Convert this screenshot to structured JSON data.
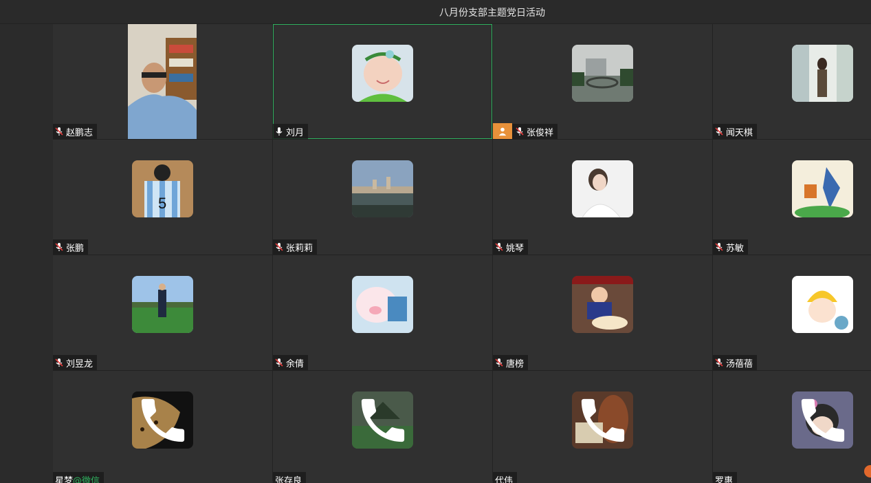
{
  "window": {
    "title": "八月份支部主题党日活动"
  },
  "participants": [
    {
      "name": "赵鹏志",
      "mic": "muted",
      "avatar": "video-portrait"
    },
    {
      "name": "刘月",
      "mic": "on",
      "avatar": "baby-photo",
      "active": true
    },
    {
      "name": "张俊祥",
      "mic": "muted",
      "avatar": "landscape-bridge",
      "badge": "host-icon"
    },
    {
      "name": "闻天棋",
      "mic": "muted",
      "avatar": "window-portrait"
    },
    {
      "name": "张鹏",
      "mic": "muted",
      "avatar": "jersey-photo"
    },
    {
      "name": "张莉莉",
      "mic": "muted",
      "avatar": "lake-city"
    },
    {
      "name": "姚琴",
      "mic": "muted",
      "avatar": "bride-photo"
    },
    {
      "name": "苏敏",
      "mic": "muted",
      "avatar": "drawing-robot"
    },
    {
      "name": "刘昱龙",
      "mic": "muted",
      "avatar": "field-suit"
    },
    {
      "name": "余倩",
      "mic": "muted",
      "avatar": "cartoon-pig"
    },
    {
      "name": "唐榜",
      "mic": "muted",
      "avatar": "child-cake"
    },
    {
      "name": "汤蓓蓓",
      "mic": "muted",
      "avatar": "cartoon-girl-hat"
    },
    {
      "name": "星梦",
      "suffix": "@微信",
      "mic": "none",
      "avatar": "leopard",
      "status": "phone-icon"
    },
    {
      "name": "张存良",
      "mic": "none",
      "avatar": "garden",
      "status": "phone-icon"
    },
    {
      "name": "代伟",
      "mic": "none",
      "avatar": "violin",
      "status": "phone-icon"
    },
    {
      "name": "罗惠",
      "mic": "none",
      "avatar": "cartoon-girl-bow",
      "status": "phone-icon"
    }
  ],
  "colors": {
    "active_border": "#2fb25f",
    "host_badge": "#e8913a",
    "mic_muted": "#e23b3b",
    "wechat": "#2fb25f"
  }
}
